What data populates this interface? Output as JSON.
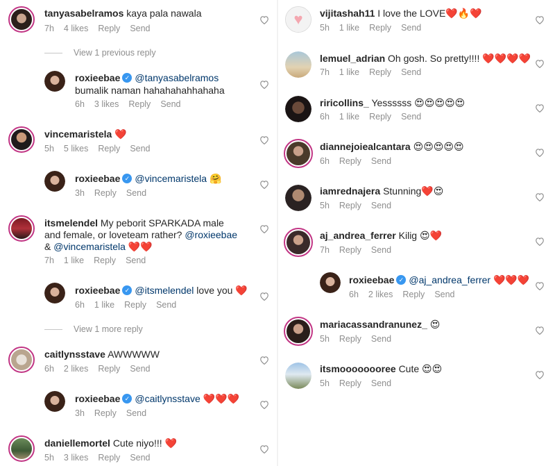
{
  "left": [
    {
      "user": "tanyasabelramos",
      "text": "kaya pala nawala",
      "time": "7h",
      "likes": "4 likes",
      "reply": "Reply",
      "send": "Send"
    },
    {
      "view": "View 1 previous reply"
    },
    {
      "user": "roxieebae",
      "mention": "@tanyasabelramos",
      "text": "bumalik naman hahahahahhahaha",
      "time": "6h",
      "likes": "3 likes",
      "reply": "Reply",
      "send": "Send"
    },
    {
      "user": "vincemaristela",
      "text": "❤️",
      "time": "5h",
      "likes": "5 likes",
      "reply": "Reply",
      "send": "Send"
    },
    {
      "user": "roxieebae",
      "mention": "@vincemaristela",
      "text": "🤗",
      "time": "3h",
      "reply": "Reply",
      "send": "Send"
    },
    {
      "user": "itsmelendel",
      "text": "My peborit SPARKADA male and female, or loveteam rather?",
      "mention1": "@roxieebae",
      "amp": "&",
      "mention2": "@vincemaristela",
      "text2": "❤️❤️",
      "time": "7h",
      "likes": "1 like",
      "reply": "Reply",
      "send": "Send"
    },
    {
      "user": "roxieebae",
      "mention": "@itsmelendel",
      "text": "love you ❤️",
      "time": "6h",
      "likes": "1 like",
      "reply": "Reply",
      "send": "Send"
    },
    {
      "view": "View 1 more reply"
    },
    {
      "user": "caitlynsstave",
      "text": "AWWWWW",
      "time": "6h",
      "likes": "2 likes",
      "reply": "Reply",
      "send": "Send"
    },
    {
      "user": "roxieebae",
      "mention": "@caitlynsstave",
      "text": "❤️❤️❤️",
      "time": "3h",
      "reply": "Reply",
      "send": "Send"
    },
    {
      "user": "daniellemortel",
      "text": "Cute niyo!!! ❤️",
      "time": "5h",
      "likes": "3 likes",
      "reply": "Reply",
      "send": "Send"
    }
  ],
  "right": [
    {
      "user": "vijitashah11",
      "text": "I love the LOVE❤️🔥❤️",
      "time": "5h",
      "likes": "1 like",
      "reply": "Reply",
      "send": "Send"
    },
    {
      "user": "lemuel_adrian",
      "text": "Oh gosh. So pretty!!!! ❤️❤️❤️❤️",
      "time": "7h",
      "likes": "1 like",
      "reply": "Reply",
      "send": "Send"
    },
    {
      "user": "riricollins_",
      "text": "Yessssss 😍😍😍😍😍",
      "time": "6h",
      "likes": "1 like",
      "reply": "Reply",
      "send": "Send"
    },
    {
      "user": "diannejoiealcantara",
      "text": "😍😍😍😍😍",
      "time": "6h",
      "reply": "Reply",
      "send": "Send"
    },
    {
      "user": "iamrednajera",
      "text": "Stunning❤️😍",
      "time": "5h",
      "reply": "Reply",
      "send": "Send"
    },
    {
      "user": "aj_andrea_ferrer",
      "text": "Kilig 😍❤️",
      "time": "7h",
      "reply": "Reply",
      "send": "Send"
    },
    {
      "user": "roxieebae",
      "mention": "@aj_andrea_ferrer",
      "text": "❤️❤️❤️",
      "time": "6h",
      "likes": "2 likes",
      "reply": "Reply",
      "send": "Send"
    },
    {
      "user": "mariacassandranunez_",
      "text": "😍",
      "time": "5h",
      "reply": "Reply",
      "send": "Send"
    },
    {
      "user": "itsmoooooooree",
      "text": "Cute 😍😍",
      "time": "5h",
      "reply": "Reply",
      "send": "Send"
    }
  ],
  "colors": {
    "ring": "#c13584",
    "verified": "#3897f0",
    "meta": "#8e8e8e",
    "mention": "#00376b"
  }
}
